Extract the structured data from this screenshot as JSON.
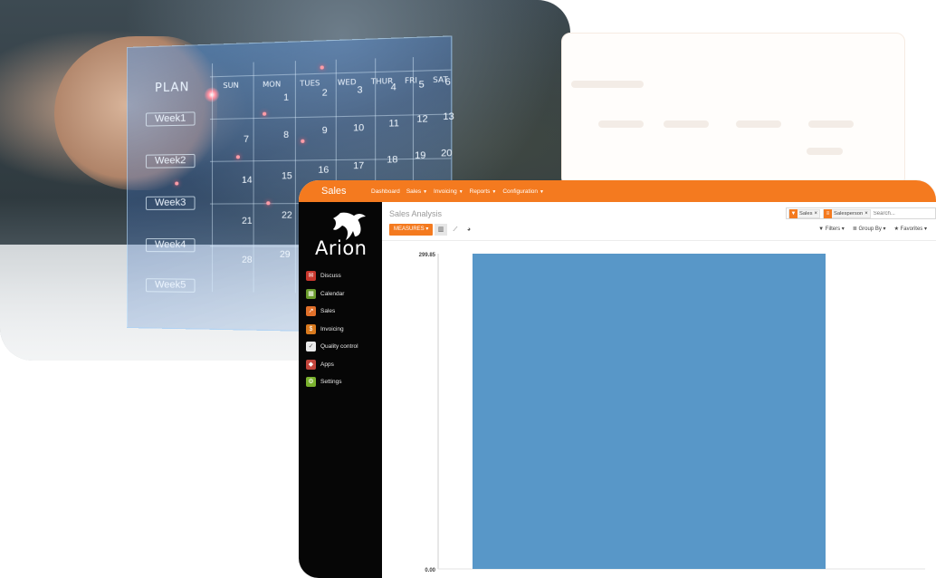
{
  "hero": {
    "plan_label": "PLAN",
    "weekdays": [
      "SUN",
      "MON",
      "TUES",
      "WED",
      "THUR",
      "FRI",
      "SAT"
    ],
    "weeks": [
      "Week1",
      "Week2",
      "Week3",
      "Week4",
      "Week5"
    ],
    "dates": [
      "1",
      "2",
      "3",
      "4",
      "5",
      "6",
      "7",
      "8",
      "9",
      "10",
      "11",
      "12",
      "13",
      "14",
      "15",
      "16",
      "17",
      "18",
      "19",
      "20",
      "21",
      "22",
      "28",
      "29"
    ]
  },
  "app": {
    "title": "Sales",
    "nav": [
      {
        "label": "Dashboard",
        "dropdown": false
      },
      {
        "label": "Sales",
        "dropdown": true
      },
      {
        "label": "Invoicing",
        "dropdown": true
      },
      {
        "label": "Reports",
        "dropdown": true
      },
      {
        "label": "Configuration",
        "dropdown": true
      }
    ],
    "logo": {
      "text": "Arion",
      "icon": "horse-head-icon"
    },
    "sidebar": [
      {
        "label": "Discuss",
        "icon": "discuss-icon",
        "color": "#c8372d"
      },
      {
        "label": "Calendar",
        "icon": "calendar-icon",
        "color": "#6a9b2c"
      },
      {
        "label": "Sales",
        "icon": "sales-icon",
        "color": "#e0702a"
      },
      {
        "label": "Invoicing",
        "icon": "invoicing-icon",
        "color": "#d97a1e"
      },
      {
        "label": "Quality control",
        "icon": "quality-control-icon",
        "color": "#e9e9e9"
      },
      {
        "label": "Apps",
        "icon": "apps-icon",
        "color": "#c2453c"
      },
      {
        "label": "Settings",
        "icon": "settings-icon",
        "color": "#7ab12e"
      }
    ],
    "breadcrumb": "Sales Analysis",
    "search": {
      "facets": [
        {
          "label": "Sales",
          "icon": "filter-icon"
        },
        {
          "label": "Salesperson",
          "icon": "group-icon"
        }
      ],
      "placeholder": "Search..."
    },
    "measures_label": "MEASURES",
    "filters": [
      {
        "label": "Filters",
        "icon": "filter-icon"
      },
      {
        "label": "Group By",
        "icon": "group-by-icon"
      },
      {
        "label": "Favorites",
        "icon": "star-icon"
      }
    ],
    "colors": {
      "accent": "#f47a1f",
      "sidebar": "#060606",
      "bar": "#5897c8"
    }
  },
  "chart_data": {
    "type": "bar",
    "categories": [
      ""
    ],
    "values": [
      299.85
    ],
    "title": "",
    "xlabel": "",
    "ylabel": "",
    "ylim": [
      0,
      299.85
    ],
    "ytick_labels": [
      "299.85",
      "0.00"
    ],
    "grid": false,
    "bar_color": "#5897c8"
  }
}
